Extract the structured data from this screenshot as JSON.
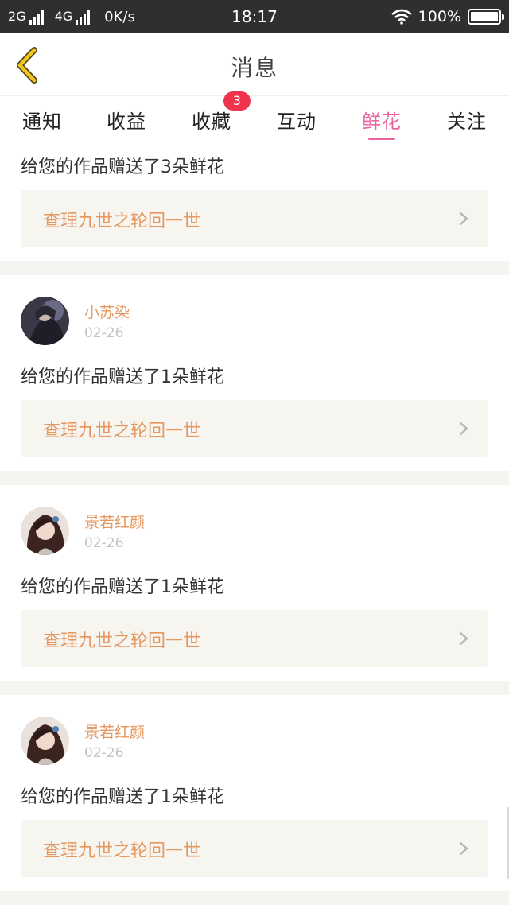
{
  "status_bar": {
    "net1_label": "2G",
    "net2_label": "4G",
    "speed": "0K/s",
    "time": "18:17",
    "battery_text": "100%"
  },
  "header": {
    "title": "消息"
  },
  "tabs": [
    {
      "label": "通知"
    },
    {
      "label": "收益"
    },
    {
      "label": "收藏",
      "badge": "3"
    },
    {
      "label": "互动"
    },
    {
      "label": "鲜花",
      "active": true
    },
    {
      "label": "关注"
    }
  ],
  "feed": [
    {
      "message": "给您的作品赠送了3朵鲜花",
      "work_title": "查理九世之轮回一世"
    },
    {
      "user": "小苏染",
      "date": "02-26",
      "message": "给您的作品赠送了1朵鲜花",
      "work_title": "查理九世之轮回一世"
    },
    {
      "user": "景若红颜",
      "date": "02-26",
      "message": "给您的作品赠送了1朵鲜花",
      "work_title": "查理九世之轮回一世"
    },
    {
      "user": "景若红颜",
      "date": "02-26",
      "message": "给您的作品赠送了1朵鲜花",
      "work_title": "查理九世之轮回一世"
    }
  ],
  "colors": {
    "accent_pink": "#e9659f",
    "name_orange": "#e59862",
    "badge_red": "#f0334c",
    "back_arrow_yellow": "#f3c61b"
  },
  "icons": [
    "signal-icon",
    "wifi-icon",
    "battery-icon",
    "back-arrow-icon",
    "chevron-right-icon"
  ]
}
